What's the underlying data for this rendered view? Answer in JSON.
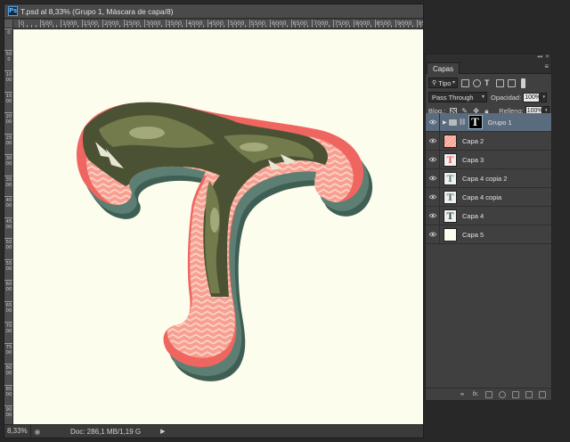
{
  "document": {
    "app_icon": "Ps",
    "title": "T.psd al 8,33% (Grupo 1, Máscara de capa/8)",
    "ruler_top": [
      "0",
      "500",
      "1000",
      "1500",
      "2000",
      "2500",
      "3000",
      "3500",
      "4000",
      "4500",
      "5000",
      "5500",
      "6000",
      "6500",
      "7000",
      "7500",
      "8000",
      "8500",
      "9000",
      "9500"
    ],
    "ruler_left": [
      "0",
      "5 0 0",
      "1 0 0 0",
      "1 5 0 0",
      "2 0 0 0",
      "2 5 0 0",
      "3 0 0 0",
      "3 5 0 0",
      "4 0 0 0",
      "4 5 0 0",
      "5 0 0 0",
      "5 5 0 0",
      "6 0 0 0",
      "6 5 0 0",
      "7 0 0 0",
      "7 5 0 0",
      "8 0 0 0",
      "8 5 0 0",
      "9 0 0 0"
    ],
    "canvas_bg": "#fdfdee",
    "artwork": {
      "description_icon": "dragon-letter-T-illustration",
      "colors": {
        "outline": "#ef6661",
        "pattern": "#f7a091",
        "chevron": "#fbd2c6",
        "shadow": "#3f5f55",
        "dragon_dark": "#4b5234",
        "dragon_mid": "#737b4c",
        "dragon_light": "#a4a97a"
      }
    },
    "status": {
      "zoom": "8,33%",
      "info": "Doc: 286,1 MB/1,19 G"
    }
  },
  "layers_panel": {
    "tab_label": "Capas",
    "filter_kind": "Tipo",
    "blend_mode": "Pass Through",
    "opacity_label": "Opacidad:",
    "opacity_value": "100%",
    "lock_label": "Bloq.:",
    "fill_label": "Relleno:",
    "fill_value": "100%",
    "layers": [
      {
        "name": "Grupo 1",
        "type": "group",
        "selected": true
      },
      {
        "name": "Capa 2",
        "type": "pattern"
      },
      {
        "name": "Capa 3",
        "type": "red-T"
      },
      {
        "name": "Capa 4 copia 2",
        "type": "T"
      },
      {
        "name": "Capa 4 copia",
        "type": "T"
      },
      {
        "name": "Capa 4",
        "type": "dark-T"
      },
      {
        "name": "Capa 5",
        "type": "blank"
      }
    ],
    "colors": {
      "selected": "#5b6b7e",
      "panel_bg": "#404040"
    }
  }
}
